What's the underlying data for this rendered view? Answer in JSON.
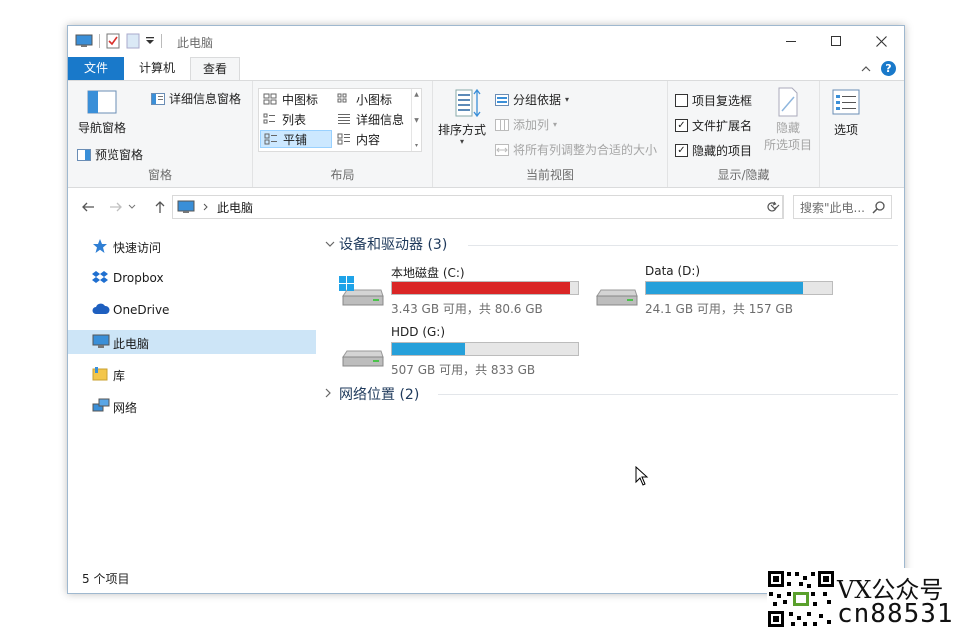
{
  "window": {
    "title": "此电脑",
    "controls": {
      "minimize": "minimize",
      "maximize": "maximize",
      "close": "close"
    }
  },
  "ribbon_tabs": [
    {
      "label": "文件"
    },
    {
      "label": "计算机"
    },
    {
      "label": "查看"
    }
  ],
  "ribbon": {
    "panes": {
      "label": "窗格",
      "nav_pane": "导航窗格",
      "preview_pane": "预览窗格",
      "details_pane": "详细信息窗格"
    },
    "layout": {
      "label": "布局",
      "items": [
        "中图标",
        "小图标",
        "列表",
        "详细信息",
        "平铺",
        "内容"
      ],
      "selected": "平铺"
    },
    "current_view": {
      "label": "当前视图",
      "sort_by": "排序方式",
      "group_by": "分组依据",
      "add_columns": "添加列",
      "size_columns": "将所有列调整为合适的大小"
    },
    "show_hide": {
      "label": "显示/隐藏",
      "item_checkboxes": {
        "label": "项目复选框",
        "checked": false
      },
      "file_extensions": {
        "label": "文件扩展名",
        "checked": true
      },
      "hidden_items": {
        "label": "隐藏的项目",
        "checked": true
      },
      "hide_selected_line1": "隐藏",
      "hide_selected_line2": "所选项目"
    },
    "options": "选项"
  },
  "address": {
    "path": "此电脑",
    "search_placeholder": "搜索\"此电..."
  },
  "sidebar": {
    "items": [
      {
        "label": "快速访问",
        "icon": "star-icon"
      },
      {
        "label": "Dropbox",
        "icon": "dropbox-icon"
      },
      {
        "label": "OneDrive",
        "icon": "cloud-icon"
      },
      {
        "label": "此电脑",
        "icon": "computer-icon",
        "selected": true
      },
      {
        "label": "库",
        "icon": "library-icon"
      },
      {
        "label": "网络",
        "icon": "network-icon"
      }
    ]
  },
  "content": {
    "devices_header": "设备和驱动器 (3)",
    "network_header": "网络位置 (2)",
    "drives": [
      {
        "name": "本地磁盘 (C:)",
        "info": "3.43 GB 可用，共 80.6 GB",
        "used_fraction": 0.957,
        "bar_color": "#da2626"
      },
      {
        "name": "Data (D:)",
        "info": "24.1 GB 可用，共 157 GB",
        "used_fraction": 0.846,
        "bar_color": "#26a0da"
      },
      {
        "name": "HDD (G:)",
        "info": "507 GB 可用，共 833 GB",
        "used_fraction": 0.391,
        "bar_color": "#26a0da"
      }
    ]
  },
  "status": {
    "item_count": "5 个项目"
  },
  "watermark": {
    "line1": "VX公众号",
    "line2": "cn88531"
  }
}
